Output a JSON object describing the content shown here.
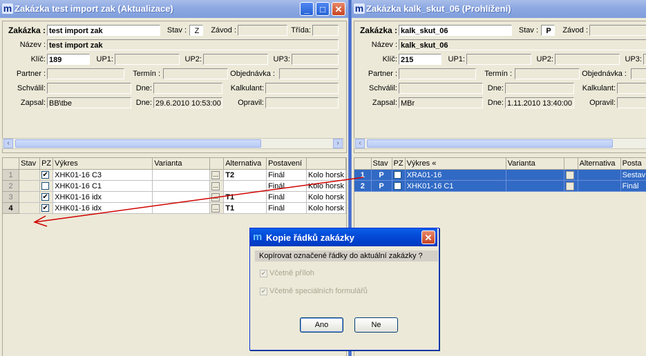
{
  "left": {
    "title": "Zakázka test import zak (Aktualizace)",
    "labels": {
      "zakazka": "Zakázka :",
      "stav": "Stav :",
      "zavod": "Závod :",
      "trida": "Třída:",
      "nazev": "Název :",
      "klic": "Klíč:",
      "up1": "UP1:",
      "up2": "UP2:",
      "up3": "UP3:",
      "partner": "Partner :",
      "termin": "Termín :",
      "objednavka": "Objednávka :",
      "schvalil": "Schválil:",
      "dne": "Dne:",
      "kalkulant": "Kalkulant:",
      "zapsal": "Zapsal:",
      "dne2": "Dne:",
      "opravil": "Opravil:"
    },
    "values": {
      "zakazka": "test import zak",
      "stav": "Z",
      "nazev": "test import zak",
      "klic": "189",
      "zapsal": "BB\\tbe",
      "dne2": "29.6.2010 10:53:00"
    },
    "grid": {
      "headers": [
        "Stav",
        "PZ",
        "Výkres",
        "Varianta",
        "",
        "Alternativa",
        "Postavení",
        ""
      ],
      "rows": [
        {
          "n": "1",
          "pz": "✔",
          "vykres": "XHK01-16 C3",
          "varianta": "",
          "alt": "T2",
          "post": "Finál",
          "extra": "Kolo horsk"
        },
        {
          "n": "2",
          "pz": "",
          "vykres": "XHK01-16 C1",
          "varianta": "",
          "alt": "",
          "post": "Finál",
          "extra": "Kolo horsk"
        },
        {
          "n": "3",
          "pz": "✔",
          "vykres": "XHK01-16 idx",
          "varianta": "",
          "alt": "T1",
          "post": "Finál",
          "extra": "Kolo horsk"
        },
        {
          "n": "4",
          "pz": "✔",
          "vykres": "XHK01-16 idx",
          "varianta": "",
          "alt": "T1",
          "post": "Finál",
          "extra": "Kolo horsk"
        }
      ]
    }
  },
  "right": {
    "title": "Zakázka kalk_skut_06 (Prohlížení)",
    "labels": {
      "zakazka": "Zakázka :",
      "stav": "Stav :",
      "zavod": "Závod :",
      "nazev": "Název :",
      "klic": "Klíč:",
      "up1": "UP1:",
      "up2": "UP2:",
      "up3": "UP3:",
      "partner": "Partner :",
      "termin": "Termín :",
      "objednavka": "Objednávka :",
      "schvalil": "Schválil:",
      "dne": "Dne:",
      "kalkulant": "Kalkulant:",
      "zapsal": "Zapsal:",
      "dne2": "Dne:",
      "opravil": "Opravil:"
    },
    "values": {
      "zakazka": "kalk_skut_06",
      "stav": "P",
      "nazev": "kalk_skut_06",
      "klic": "215",
      "zapsal": "MBr",
      "dne2": "1.11.2010 13:40:00"
    },
    "grid": {
      "headers": [
        "Stav",
        "PZ",
        "Výkres «",
        "Varianta",
        "",
        "Alternativa",
        "Posta"
      ],
      "rows": [
        {
          "n": "1",
          "stav": "P",
          "vykres": "XRA01-16",
          "varianta": "",
          "alt": "",
          "post": "Sestav"
        },
        {
          "n": "2",
          "stav": "P",
          "vykres": "XHK01-16 C1",
          "varianta": "",
          "alt": "",
          "post": "Finál"
        }
      ]
    }
  },
  "dialog": {
    "title": "Kopie řádků zakázky",
    "message": "Kopírovat označené řádky do aktuální zakázky ?",
    "opt1": "Včetně příloh",
    "opt2": "Včetně speciálních formulářů",
    "yes": "Ano",
    "no": "Ne"
  },
  "colors": {
    "selection": "#316ac5",
    "arrow": "#d00000",
    "dialog_title": "#0347d4"
  }
}
